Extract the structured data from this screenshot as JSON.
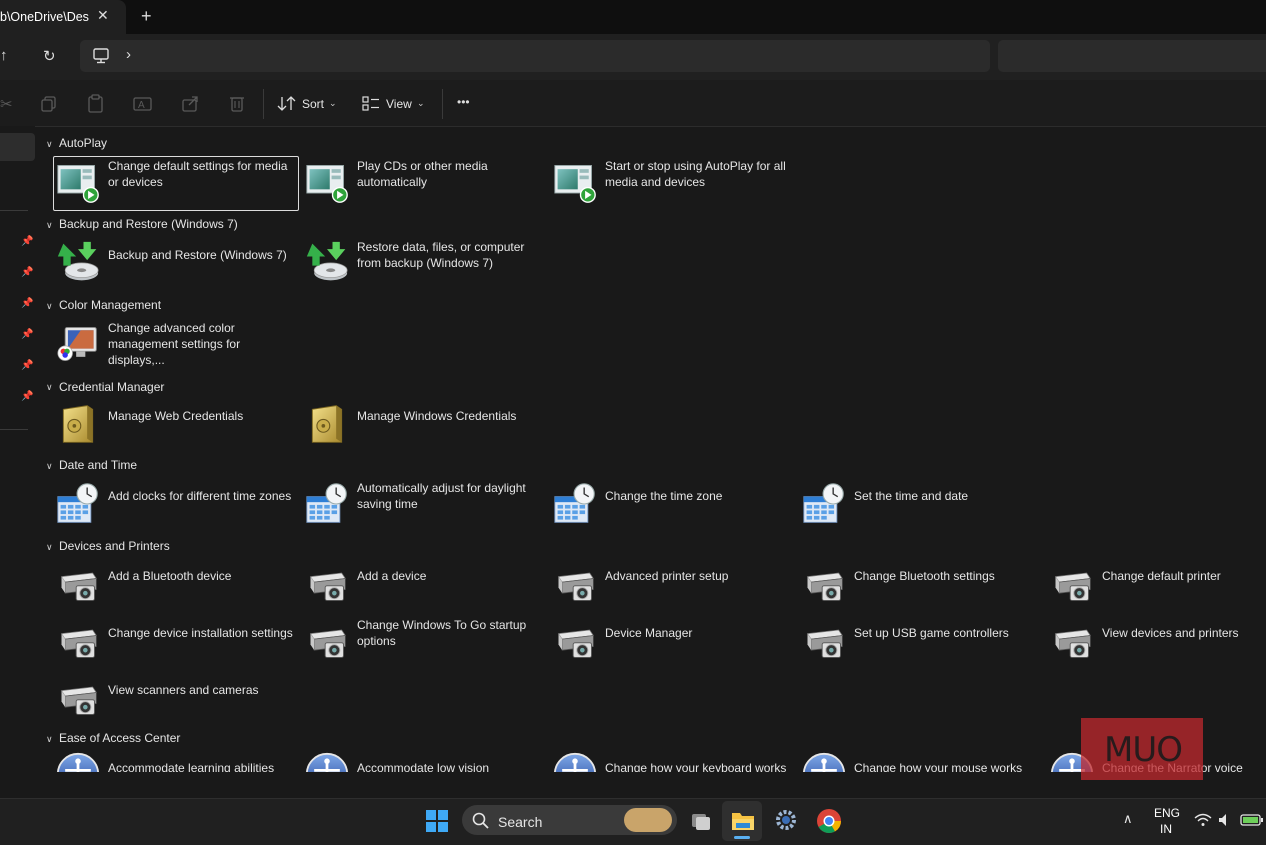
{
  "tab": {
    "title": "b\\OneDrive\\Des",
    "close_icon": "close-icon",
    "new_tab_icon": "plus-icon"
  },
  "toolbar": {
    "sort_label": "Sort",
    "view_label": "View",
    "more_label": "•••"
  },
  "groups": [
    {
      "title": "AutoPlay",
      "items": [
        {
          "label": "Change default settings for media or devices",
          "icon": "autoplay-icon"
        },
        {
          "label": "Play CDs or other media automatically",
          "icon": "autoplay-icon"
        },
        {
          "label": "Start or stop using AutoPlay for all media and devices",
          "icon": "autoplay-icon"
        }
      ]
    },
    {
      "title": "Backup and Restore (Windows 7)",
      "items": [
        {
          "label": "Backup and Restore (Windows 7)",
          "icon": "backup-icon"
        },
        {
          "label": "Restore data, files, or computer from backup (Windows 7)",
          "icon": "backup-icon"
        }
      ]
    },
    {
      "title": "Color Management",
      "items": [
        {
          "label": "Change advanced color management settings for displays,...",
          "icon": "color-management-icon"
        }
      ]
    },
    {
      "title": "Credential Manager",
      "items": [
        {
          "label": "Manage Web Credentials",
          "icon": "vault-icon"
        },
        {
          "label": "Manage Windows Credentials",
          "icon": "vault-icon"
        }
      ]
    },
    {
      "title": "Date and Time",
      "items": [
        {
          "label": "Add clocks for different time zones",
          "icon": "clock-calendar-icon"
        },
        {
          "label": "Automatically adjust for daylight saving time",
          "icon": "clock-calendar-icon"
        },
        {
          "label": "Change the time zone",
          "icon": "clock-calendar-icon"
        },
        {
          "label": "Set the time and date",
          "icon": "clock-calendar-icon"
        }
      ]
    },
    {
      "title": "Devices and Printers",
      "items": [
        {
          "label": "Add a Bluetooth device",
          "icon": "printer-camera-icon"
        },
        {
          "label": "Add a device",
          "icon": "printer-camera-icon"
        },
        {
          "label": "Advanced printer setup",
          "icon": "printer-camera-icon"
        },
        {
          "label": "Change Bluetooth settings",
          "icon": "printer-camera-icon"
        },
        {
          "label": "Change default printer",
          "icon": "printer-camera-icon"
        },
        {
          "label": "Change device installation settings",
          "icon": "printer-camera-icon"
        },
        {
          "label": "Change Windows To Go startup options",
          "icon": "printer-camera-icon"
        },
        {
          "label": "Device Manager",
          "icon": "printer-camera-icon"
        },
        {
          "label": "Set up USB game controllers",
          "icon": "printer-camera-icon"
        },
        {
          "label": "View devices and printers",
          "icon": "printer-camera-icon"
        },
        {
          "label": "View scanners and cameras",
          "icon": "printer-camera-icon"
        }
      ]
    },
    {
      "title": "Ease of Access Center",
      "items": [
        {
          "label": "Accommodate learning abilities",
          "icon": "ease-of-access-icon"
        },
        {
          "label": "Accommodate low vision",
          "icon": "ease-of-access-icon"
        },
        {
          "label": "Change how your keyboard works",
          "icon": "ease-of-access-icon"
        },
        {
          "label": "Change how your mouse works",
          "icon": "ease-of-access-icon"
        },
        {
          "label": "Change the Narrator voice",
          "icon": "ease-of-access-icon"
        }
      ]
    }
  ],
  "taskbar": {
    "search_label": "Search",
    "lang_line1": "ENG",
    "lang_line2": "IN"
  },
  "watermark": {
    "text": "MUO"
  }
}
